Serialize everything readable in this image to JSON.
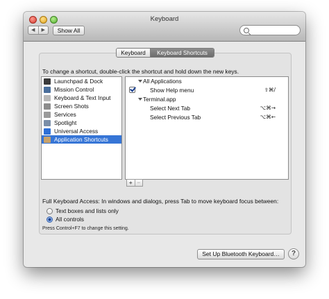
{
  "window": {
    "title": "Keyboard"
  },
  "toolbar": {
    "back_glyph": "◀",
    "forward_glyph": "▶",
    "show_all_label": "Show All",
    "search_value": ""
  },
  "tabs": [
    {
      "label": "Keyboard",
      "selected": false
    },
    {
      "label": "Keyboard Shortcuts",
      "selected": true
    }
  ],
  "instructions": "To change a shortcut, double-click the shortcut and hold down the new keys.",
  "categories": [
    {
      "label": "Launchpad & Dock",
      "icon": "launchpad-dock-icon",
      "color": "#3a3a3a",
      "selected": false
    },
    {
      "label": "Mission Control",
      "icon": "mission-control-icon",
      "color": "#4a6f9c",
      "selected": false
    },
    {
      "label": "Keyboard & Text Input",
      "icon": "keyboard-icon",
      "color": "#b8b8b8",
      "selected": false
    },
    {
      "label": "Screen Shots",
      "icon": "screenshot-icon",
      "color": "#8c8c8c",
      "selected": false
    },
    {
      "label": "Services",
      "icon": "gear-icon",
      "color": "#9a9a9a",
      "selected": false
    },
    {
      "label": "Spotlight",
      "icon": "spotlight-icon",
      "color": "#7a8ea8",
      "selected": false
    },
    {
      "label": "Universal Access",
      "icon": "universal-access-icon",
      "color": "#2d6fd6",
      "selected": false
    },
    {
      "label": "Application Shortcuts",
      "icon": "app-shortcuts-icon",
      "color": "#c8a26a",
      "selected": true
    }
  ],
  "shortcuts": [
    {
      "type": "group",
      "label": "All Applications",
      "key": ""
    },
    {
      "type": "item",
      "label": "Show Help menu",
      "key": "⇧⌘/",
      "checked": true
    },
    {
      "type": "group",
      "label": "Terminal.app",
      "key": ""
    },
    {
      "type": "item",
      "label": "Select Next Tab",
      "key": "⌥⌘→",
      "checked": false
    },
    {
      "type": "item",
      "label": "Select Previous Tab",
      "key": "⌥⌘←",
      "checked": false
    }
  ],
  "add_remove": {
    "add": "+",
    "remove": "−"
  },
  "full_keyboard_access": {
    "label": "Full Keyboard Access: In windows and dialogs, press Tab to move keyboard focus between:",
    "options": [
      {
        "label": "Text boxes and lists only",
        "selected": false
      },
      {
        "label": "All controls",
        "selected": true
      }
    ],
    "note": "Press Control+F7 to change this setting."
  },
  "footer": {
    "bluetooth_button": "Set Up Bluetooth Keyboard…",
    "help_glyph": "?"
  },
  "colors": {
    "selection": "#3675d6",
    "selected_tab": "#7a7a7a"
  }
}
